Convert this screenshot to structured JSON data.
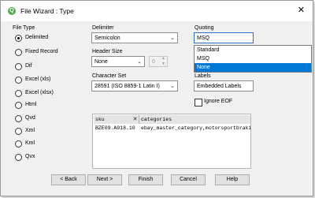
{
  "window": {
    "title": "File Wizard : Type",
    "app_icon": "qlik-icon",
    "close_glyph": "✕"
  },
  "file_type": {
    "label": "File Type",
    "options": [
      {
        "label": "Delimited",
        "selected": true
      },
      {
        "label": "Fixed Record",
        "selected": false
      },
      {
        "label": "Dif",
        "selected": false
      },
      {
        "label": "Excel (xls)",
        "selected": false
      },
      {
        "label": "Excel (xlsx)",
        "selected": false
      },
      {
        "label": "Html",
        "selected": false
      },
      {
        "label": "Qvd",
        "selected": false
      },
      {
        "label": "Xml",
        "selected": false
      },
      {
        "label": "Kml",
        "selected": false
      },
      {
        "label": "Qvx",
        "selected": false
      }
    ]
  },
  "delimiter": {
    "label": "Delimiter",
    "value": "Semicolon"
  },
  "header_size": {
    "label": "Header Size",
    "value": "None",
    "spin_value": "0"
  },
  "character_set": {
    "label": "Character Set",
    "value": "28591 (ISO 8859-1 Latin I)"
  },
  "quoting": {
    "label": "Quoting",
    "value": "MSQ",
    "options": [
      "Standard",
      "MSQ",
      "None"
    ],
    "highlighted": "None"
  },
  "labels": {
    "label": "Labels",
    "value": "Embedded Labels"
  },
  "ignore_eof": {
    "label": "Ignore EOF",
    "checked": false
  },
  "preview": {
    "headers": [
      "sku",
      "categories"
    ],
    "rows": [
      [
        "BZE09.A918.10",
        "ebay_master_category,motorsportbrakingc"
      ]
    ],
    "close_glyph": "✕"
  },
  "buttons": {
    "back": "< Back",
    "next": "Next >",
    "finish": "Finish",
    "cancel": "Cancel",
    "help": "Help"
  },
  "colors": {
    "accent": "#0078d7",
    "app_icon": "#54a94e",
    "dialog_bg": "#f0f0f0"
  }
}
